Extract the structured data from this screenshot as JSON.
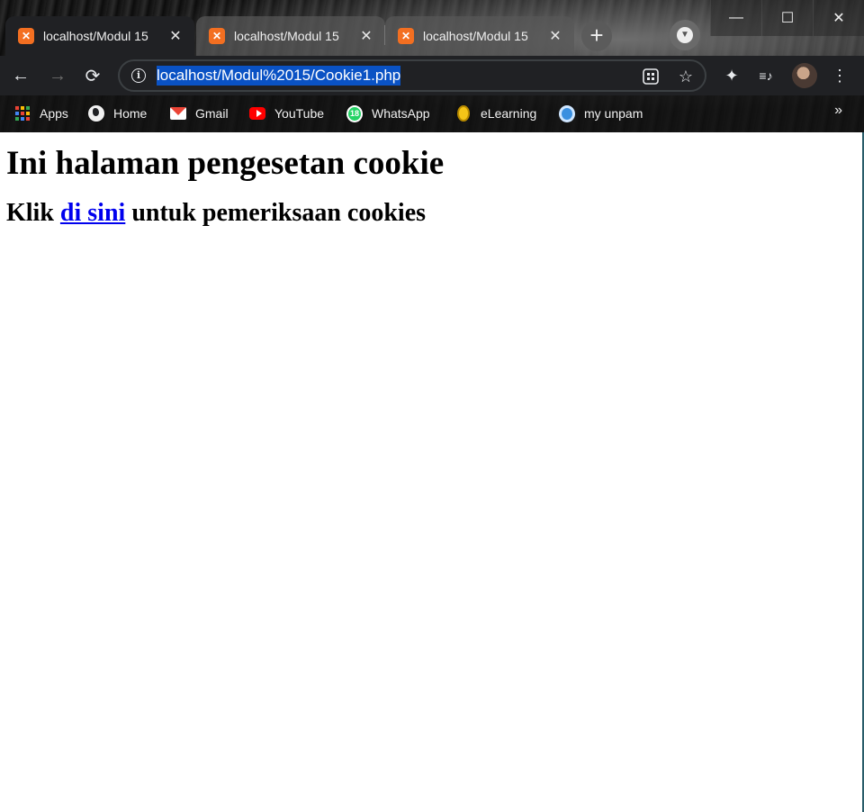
{
  "tabs": [
    {
      "title": "localhost/Modul 15",
      "close": "✕",
      "active": true
    },
    {
      "title": "localhost/Modul 15",
      "close": "✕",
      "active": false
    },
    {
      "title": "localhost/Modul 15",
      "close": "✕",
      "active": false
    }
  ],
  "new_tab_label": "+",
  "window_controls": {
    "minimize": "—",
    "maximize": "☐",
    "close": "✕"
  },
  "toolbar": {
    "back": "←",
    "forward": "→",
    "reload": "⟳",
    "info": "i",
    "url": "localhost/Modul%2015/Cookie1.php",
    "bookmark_star": "☆",
    "extensions": "✦",
    "media": "≡♪",
    "menu": "⋮"
  },
  "bookmarks": {
    "items": [
      {
        "label": "Apps",
        "icon": "apps-grid-icon"
      },
      {
        "label": "Home",
        "icon": "globe-icon"
      },
      {
        "label": "Gmail",
        "icon": "gmail-icon"
      },
      {
        "label": "YouTube",
        "icon": "youtube-icon"
      },
      {
        "label": "WhatsApp",
        "icon": "whatsapp-icon",
        "badge": "18"
      },
      {
        "label": "eLearning",
        "icon": "elearning-icon"
      },
      {
        "label": "my unpam",
        "icon": "unpam-icon"
      }
    ],
    "more": "»"
  },
  "page": {
    "heading": "Ini halaman pengesetan cookie",
    "sub_prefix": "Klik ",
    "link_text": "di sini",
    "sub_suffix": " untuk pemeriksaan cookies"
  },
  "colors": {
    "selection": "#0a52c4",
    "link": "#0000ee",
    "tab_active": "#202124",
    "favicon": "#f36f21"
  }
}
